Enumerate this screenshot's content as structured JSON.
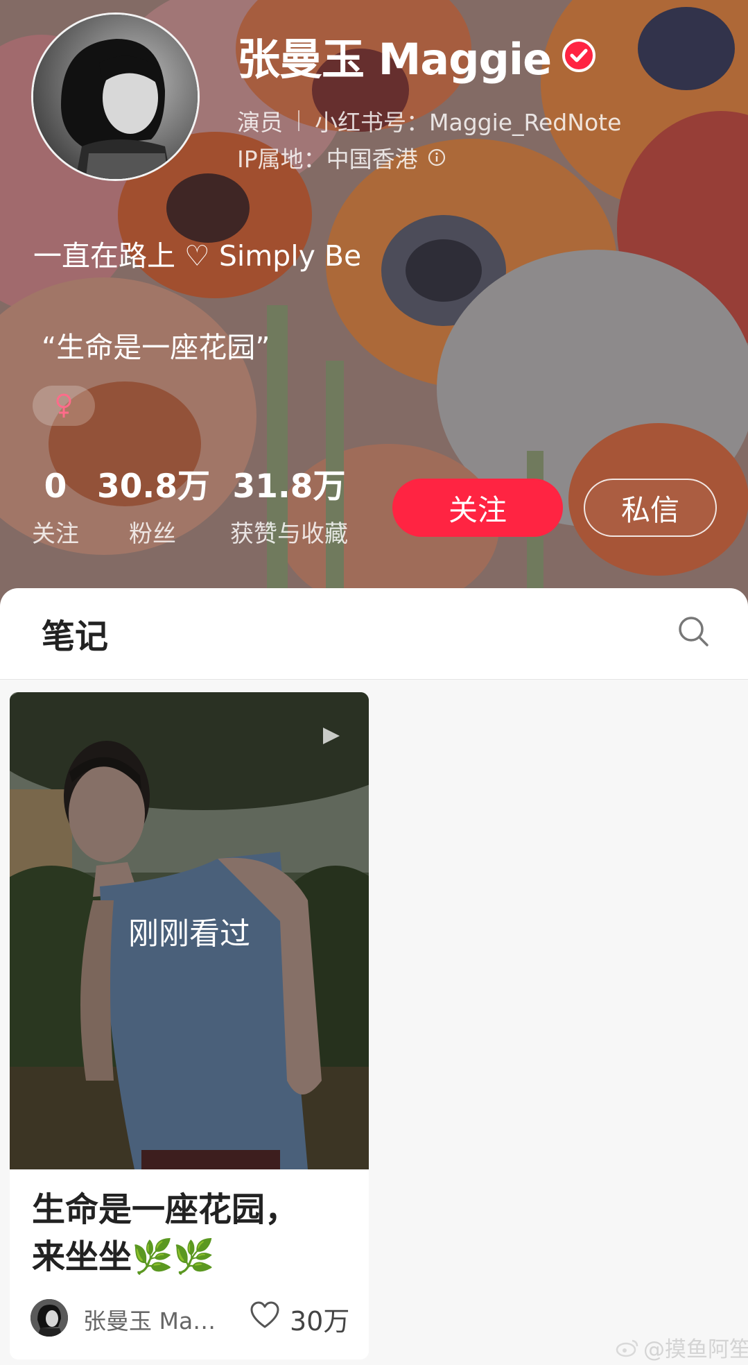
{
  "profile": {
    "display_name": "张曼玉 Maggie",
    "role": "演员",
    "red_id": "小红书号：Maggie_RedNote",
    "ip_location": "IP属地：中国香港",
    "bio_line1": "一直在路上 ♡ Simply Be",
    "bio_line2": "“生命是一座花园”",
    "gender_symbol": "♀"
  },
  "stats": {
    "following_count": "0",
    "following_label": "关注",
    "fans_count": "30.8万",
    "fans_label": "粉丝",
    "likes_count": "31.8万",
    "likes_label": "获赞与收藏"
  },
  "actions": {
    "follow_label": "关注",
    "message_label": "私信"
  },
  "tabs": {
    "notes_label": "笔记"
  },
  "notes": [
    {
      "overlay_label": "刚刚看过",
      "title_line1": "生命是一座花园，",
      "title_line2": "来坐坐🌿🌿",
      "author": "张曼玉 Ma…",
      "likes": "30万"
    }
  ],
  "watermark": "@摸鱼阿笙",
  "colors": {
    "accent": "#ff2442",
    "verified_badge": "#ff2442",
    "gender_female": "#ff6b8a"
  }
}
